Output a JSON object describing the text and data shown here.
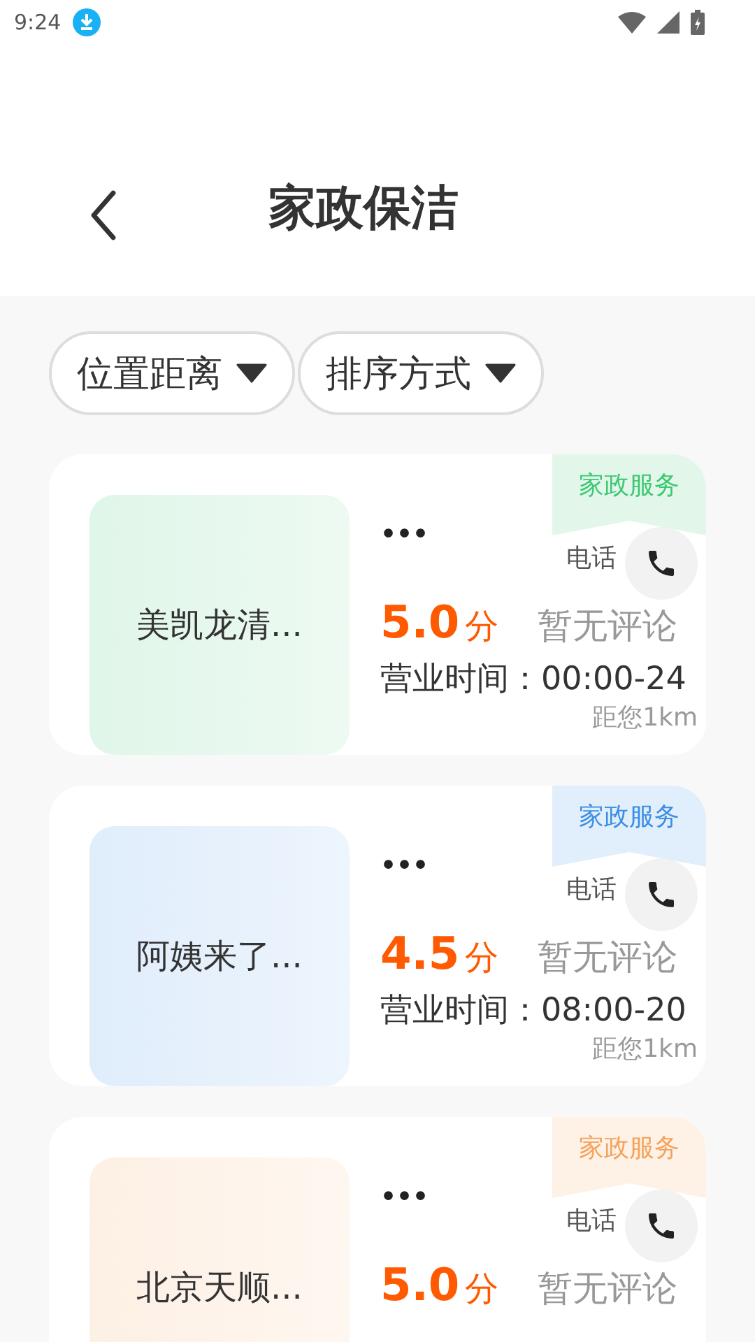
{
  "status_bar": {
    "time": "9:24"
  },
  "header": {
    "title": "家政保洁"
  },
  "filters": [
    {
      "label": "位置距离"
    },
    {
      "label": "排序方式"
    }
  ],
  "shops": [
    {
      "name": "美凯龙清...",
      "tag": "家政服务",
      "color": "#3cc872",
      "dots": "•••",
      "score": "5.0",
      "score_unit": "分",
      "review": "暂无评论",
      "phone_label": "电话",
      "hours_label": "营业时间：",
      "hours": "00:00-24",
      "distance": "距您1km"
    },
    {
      "name": "阿姨来了...",
      "tag": "家政服务",
      "color": "#3a8ee6",
      "dots": "•••",
      "score": "4.5",
      "score_unit": "分",
      "review": "暂无评论",
      "phone_label": "电话",
      "hours_label": "营业时间：",
      "hours": "08:00-20",
      "distance": "距您1km"
    },
    {
      "name": "北京天顺...",
      "tag": "家政服务",
      "color": "#f5a25a",
      "dots": "•••",
      "score": "5.0",
      "score_unit": "分",
      "review": "暂无评论",
      "phone_label": "电话"
    }
  ]
}
